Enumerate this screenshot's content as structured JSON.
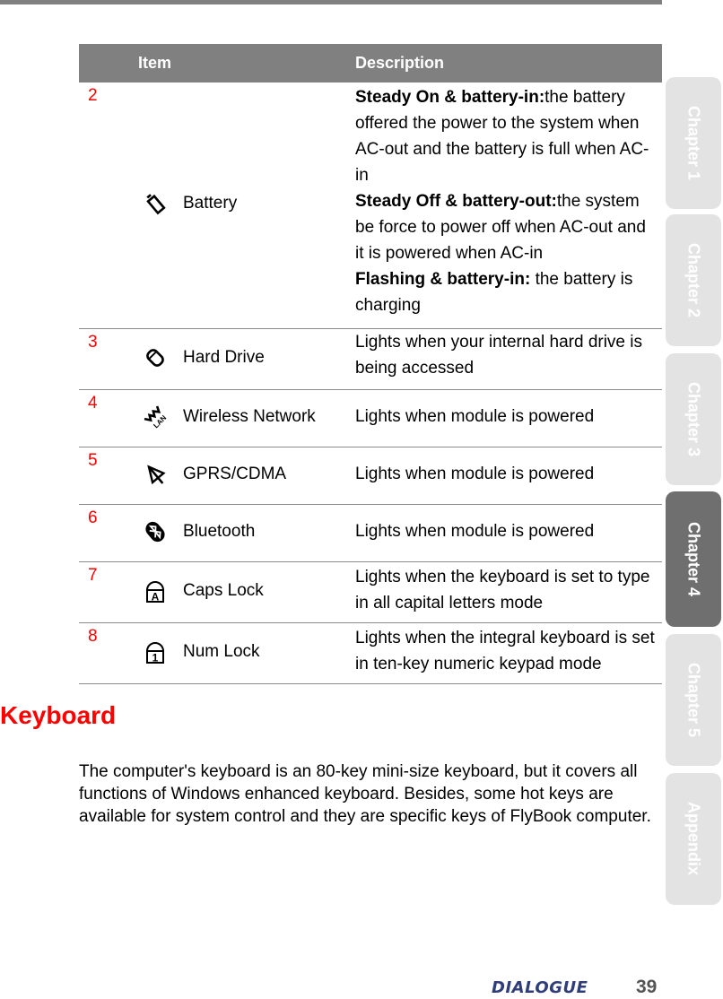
{
  "table": {
    "headers": {
      "item": "Item",
      "description": "Description"
    },
    "rows": [
      {
        "number": "2",
        "icon": "battery-icon",
        "item": "Battery",
        "description": [
          {
            "bold": "Steady On & battery-in:",
            "text": "the battery offered the power to the system when AC-out and the battery is full when AC-in"
          },
          {
            "bold": "Steady Off & battery-out:",
            "text": "the system be force to power off when AC-out and it is powered when AC-in"
          },
          {
            "bold": "Flashing & battery-in:",
            "text": " the battery is charging"
          }
        ]
      },
      {
        "number": "3",
        "icon": "hard-drive-icon",
        "item": "Hard Drive",
        "description_text": "Lights when your internal hard drive is being accessed"
      },
      {
        "number": "4",
        "icon": "wireless-lan-icon",
        "item": "Wireless Network",
        "description_text": "Lights when module is powered"
      },
      {
        "number": "5",
        "icon": "antenna-icon",
        "item": "GPRS/CDMA",
        "description_text": "Lights when module is powered"
      },
      {
        "number": "6",
        "icon": "bluetooth-icon",
        "item": "Bluetooth",
        "description_text": "Lights when module is powered"
      },
      {
        "number": "7",
        "icon": "caps-lock-icon",
        "item": "Caps Lock",
        "description_text": "Lights when the keyboard is set to type in all capital letters mode"
      },
      {
        "number": "8",
        "icon": "num-lock-icon",
        "item": "Num Lock",
        "description_text": "Lights when the integral keyboard is set in ten-key numeric keypad mode"
      }
    ]
  },
  "section": {
    "title": "Keyboard",
    "paragraph": "The computer's keyboard is an 80-key mini-size keyboard, but it covers all functions of Windows enhanced keyboard. Besides, some hot keys are available for system control and they are specific keys of FlyBook computer."
  },
  "tabs": [
    {
      "label": "Chapter 1",
      "active": false
    },
    {
      "label": "Chapter 2",
      "active": false
    },
    {
      "label": "Chapter 3",
      "active": false
    },
    {
      "label": "Chapter 4",
      "active": true
    },
    {
      "label": "Chapter 5",
      "active": false
    },
    {
      "label": "Appendix",
      "active": false
    }
  ],
  "footer": {
    "brand": "DIALOGUE",
    "page_number": "39"
  },
  "colors": {
    "header_bg": "#808080",
    "accent_red": "#ff0000",
    "tab_inactive": "#e3e3e3",
    "tab_active": "#6f6f6f",
    "brand": "#2f3d7a"
  }
}
